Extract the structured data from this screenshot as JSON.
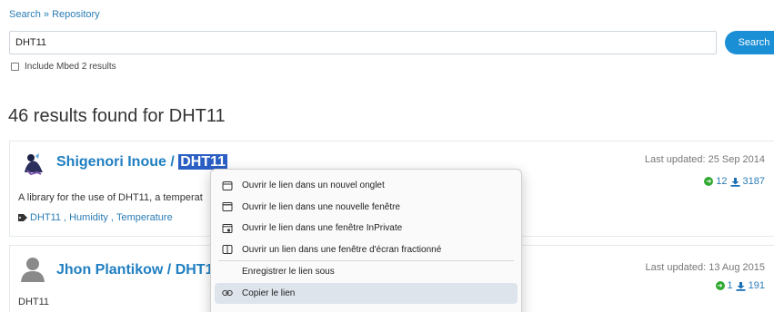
{
  "breadcrumb": {
    "search": "Search",
    "separator": "»",
    "repository": "Repository"
  },
  "search": {
    "value": "DHT11",
    "button_label": "Search"
  },
  "mbed_option": {
    "label": "Include Mbed 2 results",
    "checked": false
  },
  "results_heading": "46 results found for DHT11",
  "results": [
    {
      "author": "Shigenori Inoue",
      "separator": " / ",
      "repo": "DHT11",
      "updated": "Last updated: 25 Sep 2014",
      "imports": "12",
      "downloads": "3187",
      "description": "A library for the use of DHT11, a temperat",
      "tags": [
        "DHT11",
        "Humidity",
        "Temperature"
      ],
      "tag_separator": ", "
    },
    {
      "author": "Jhon Plantikow",
      "separator": " / ",
      "repo": "DHT11",
      "updated": "Last updated: 13 Aug 2015",
      "imports": "1",
      "downloads": "191",
      "description": "DHT11"
    }
  ],
  "context_menu": {
    "items": [
      {
        "label": "Ouvrir le lien dans un nouvel onglet",
        "icon": "new-tab-icon"
      },
      {
        "label": "Ouvrir le lien dans une nouvelle fenêtre",
        "icon": "new-window-icon"
      },
      {
        "label": "Ouvrir le lien dans une fenêtre InPrivate",
        "icon": "inprivate-window-icon"
      },
      {
        "label": "Ouvrir un lien dans une fenêtre d'écran fractionné",
        "icon": "split-screen-icon"
      },
      {
        "label": "Enregistrer le lien sous",
        "icon": ""
      },
      {
        "label": "Copier le lien",
        "icon": "link-icon",
        "highlighted": true
      }
    ]
  },
  "colors": {
    "link": "#1f7fc1",
    "button": "#1a8fd6",
    "selection": "#2b5fc4",
    "import_green": "#33aa33"
  }
}
